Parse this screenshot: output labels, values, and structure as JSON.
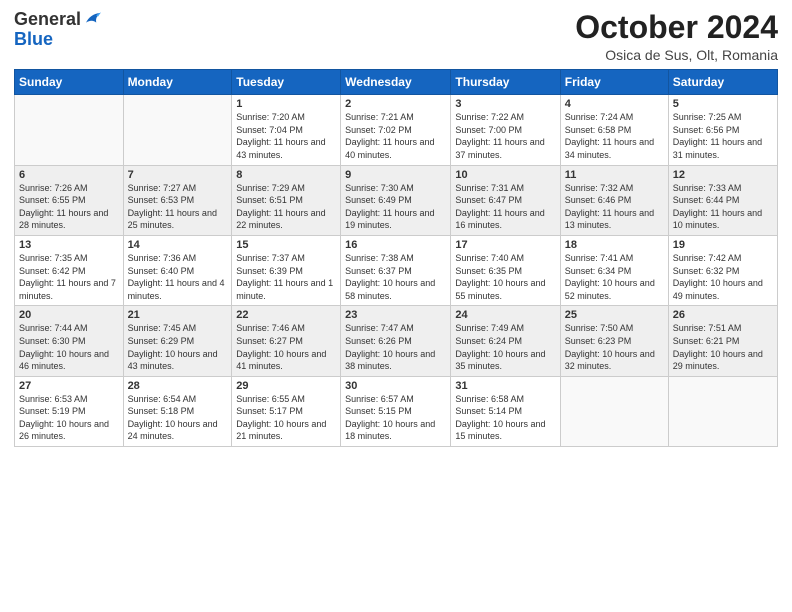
{
  "header": {
    "logo_general": "General",
    "logo_blue": "Blue",
    "month_title": "October 2024",
    "location": "Osica de Sus, Olt, Romania"
  },
  "weekdays": [
    "Sunday",
    "Monday",
    "Tuesday",
    "Wednesday",
    "Thursday",
    "Friday",
    "Saturday"
  ],
  "weeks": [
    [
      {
        "day": "",
        "info": ""
      },
      {
        "day": "",
        "info": ""
      },
      {
        "day": "1",
        "info": "Sunrise: 7:20 AM\nSunset: 7:04 PM\nDaylight: 11 hours and 43 minutes."
      },
      {
        "day": "2",
        "info": "Sunrise: 7:21 AM\nSunset: 7:02 PM\nDaylight: 11 hours and 40 minutes."
      },
      {
        "day": "3",
        "info": "Sunrise: 7:22 AM\nSunset: 7:00 PM\nDaylight: 11 hours and 37 minutes."
      },
      {
        "day": "4",
        "info": "Sunrise: 7:24 AM\nSunset: 6:58 PM\nDaylight: 11 hours and 34 minutes."
      },
      {
        "day": "5",
        "info": "Sunrise: 7:25 AM\nSunset: 6:56 PM\nDaylight: 11 hours and 31 minutes."
      }
    ],
    [
      {
        "day": "6",
        "info": "Sunrise: 7:26 AM\nSunset: 6:55 PM\nDaylight: 11 hours and 28 minutes."
      },
      {
        "day": "7",
        "info": "Sunrise: 7:27 AM\nSunset: 6:53 PM\nDaylight: 11 hours and 25 minutes."
      },
      {
        "day": "8",
        "info": "Sunrise: 7:29 AM\nSunset: 6:51 PM\nDaylight: 11 hours and 22 minutes."
      },
      {
        "day": "9",
        "info": "Sunrise: 7:30 AM\nSunset: 6:49 PM\nDaylight: 11 hours and 19 minutes."
      },
      {
        "day": "10",
        "info": "Sunrise: 7:31 AM\nSunset: 6:47 PM\nDaylight: 11 hours and 16 minutes."
      },
      {
        "day": "11",
        "info": "Sunrise: 7:32 AM\nSunset: 6:46 PM\nDaylight: 11 hours and 13 minutes."
      },
      {
        "day": "12",
        "info": "Sunrise: 7:33 AM\nSunset: 6:44 PM\nDaylight: 11 hours and 10 minutes."
      }
    ],
    [
      {
        "day": "13",
        "info": "Sunrise: 7:35 AM\nSunset: 6:42 PM\nDaylight: 11 hours and 7 minutes."
      },
      {
        "day": "14",
        "info": "Sunrise: 7:36 AM\nSunset: 6:40 PM\nDaylight: 11 hours and 4 minutes."
      },
      {
        "day": "15",
        "info": "Sunrise: 7:37 AM\nSunset: 6:39 PM\nDaylight: 11 hours and 1 minute."
      },
      {
        "day": "16",
        "info": "Sunrise: 7:38 AM\nSunset: 6:37 PM\nDaylight: 10 hours and 58 minutes."
      },
      {
        "day": "17",
        "info": "Sunrise: 7:40 AM\nSunset: 6:35 PM\nDaylight: 10 hours and 55 minutes."
      },
      {
        "day": "18",
        "info": "Sunrise: 7:41 AM\nSunset: 6:34 PM\nDaylight: 10 hours and 52 minutes."
      },
      {
        "day": "19",
        "info": "Sunrise: 7:42 AM\nSunset: 6:32 PM\nDaylight: 10 hours and 49 minutes."
      }
    ],
    [
      {
        "day": "20",
        "info": "Sunrise: 7:44 AM\nSunset: 6:30 PM\nDaylight: 10 hours and 46 minutes."
      },
      {
        "day": "21",
        "info": "Sunrise: 7:45 AM\nSunset: 6:29 PM\nDaylight: 10 hours and 43 minutes."
      },
      {
        "day": "22",
        "info": "Sunrise: 7:46 AM\nSunset: 6:27 PM\nDaylight: 10 hours and 41 minutes."
      },
      {
        "day": "23",
        "info": "Sunrise: 7:47 AM\nSunset: 6:26 PM\nDaylight: 10 hours and 38 minutes."
      },
      {
        "day": "24",
        "info": "Sunrise: 7:49 AM\nSunset: 6:24 PM\nDaylight: 10 hours and 35 minutes."
      },
      {
        "day": "25",
        "info": "Sunrise: 7:50 AM\nSunset: 6:23 PM\nDaylight: 10 hours and 32 minutes."
      },
      {
        "day": "26",
        "info": "Sunrise: 7:51 AM\nSunset: 6:21 PM\nDaylight: 10 hours and 29 minutes."
      }
    ],
    [
      {
        "day": "27",
        "info": "Sunrise: 6:53 AM\nSunset: 5:19 PM\nDaylight: 10 hours and 26 minutes."
      },
      {
        "day": "28",
        "info": "Sunrise: 6:54 AM\nSunset: 5:18 PM\nDaylight: 10 hours and 24 minutes."
      },
      {
        "day": "29",
        "info": "Sunrise: 6:55 AM\nSunset: 5:17 PM\nDaylight: 10 hours and 21 minutes."
      },
      {
        "day": "30",
        "info": "Sunrise: 6:57 AM\nSunset: 5:15 PM\nDaylight: 10 hours and 18 minutes."
      },
      {
        "day": "31",
        "info": "Sunrise: 6:58 AM\nSunset: 5:14 PM\nDaylight: 10 hours and 15 minutes."
      },
      {
        "day": "",
        "info": ""
      },
      {
        "day": "",
        "info": ""
      }
    ]
  ]
}
